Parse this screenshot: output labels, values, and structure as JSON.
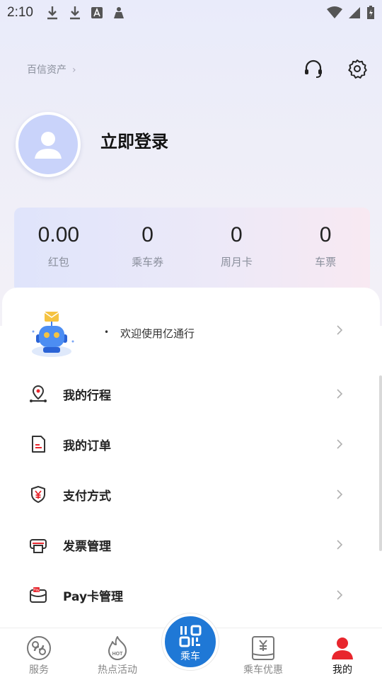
{
  "status_bar": {
    "time": "2:10"
  },
  "header": {
    "brand_link": "百信资产",
    "chevron": "›"
  },
  "profile": {
    "login_label": "立即登录"
  },
  "stats": [
    {
      "value": "0.00",
      "label": "红包"
    },
    {
      "value": "0",
      "label": "乘车券"
    },
    {
      "value": "0",
      "label": "周月卡"
    },
    {
      "value": "0",
      "label": "车票"
    }
  ],
  "welcome": {
    "bullet": "•",
    "text": "欢迎使用亿通行"
  },
  "menu": [
    {
      "label": "我的行程",
      "icon": "location-route-icon"
    },
    {
      "label": "我的订单",
      "icon": "order-doc-icon"
    },
    {
      "label": "支付方式",
      "icon": "yuan-shield-icon"
    },
    {
      "label": "发票管理",
      "icon": "printer-invoice-icon"
    },
    {
      "label": "Pay卡管理",
      "icon": "pay-card-icon"
    }
  ],
  "tabs": [
    {
      "label": "服务",
      "icon": "service-icon"
    },
    {
      "label": "热点活动",
      "icon": "hot-flame-icon"
    },
    {
      "label": "乘车",
      "icon": "qr-code-icon"
    },
    {
      "label": "乘车优惠",
      "icon": "coupon-yuan-icon"
    },
    {
      "label": "我的",
      "icon": "user-icon"
    }
  ],
  "colors": {
    "accent": "#1f78d6",
    "active_tab": "#e8262d",
    "icon_dark": "#333333",
    "icon_red": "#e8262d"
  }
}
